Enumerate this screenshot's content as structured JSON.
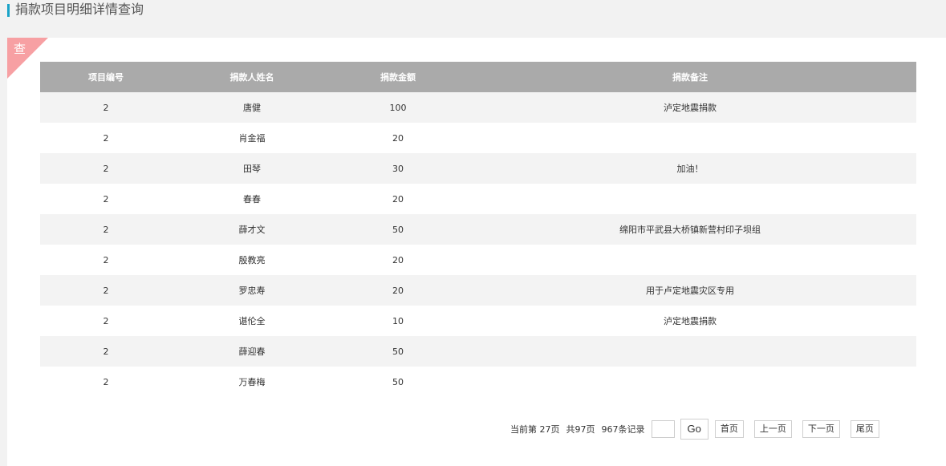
{
  "header": {
    "title": "捐款项目明细详情查询"
  },
  "panel": {
    "corner_label": "查"
  },
  "table": {
    "headers": [
      "项目编号",
      "捐款人姓名",
      "捐款金额",
      "捐款备注"
    ],
    "rows": [
      [
        "2",
        "唐健",
        "100",
        "泸定地震捐款"
      ],
      [
        "2",
        "肖金福",
        "20",
        ""
      ],
      [
        "2",
        "田琴",
        "30",
        "加油！"
      ],
      [
        "2",
        "春春",
        "20",
        ""
      ],
      [
        "2",
        "薛才文",
        "50",
        "绵阳市平武县大桥镇新营村印子坝组"
      ],
      [
        "2",
        "殷教亮",
        "20",
        ""
      ],
      [
        "2",
        "罗忠寿",
        "20",
        "用于卢定地震灾区专用"
      ],
      [
        "2",
        "谌伦全",
        "10",
        "泸定地震捐款"
      ],
      [
        "2",
        "薛迎春",
        "50",
        ""
      ],
      [
        "2",
        "万春梅",
        "50",
        ""
      ]
    ]
  },
  "pager": {
    "current_text": "当前第 27页",
    "total_pages_text": "共97页",
    "records_text": "967条记录",
    "page_input_value": "",
    "go_label": "Go",
    "first_label": "首页",
    "prev_label": "上一页",
    "next_label": "下一页",
    "last_label": "尾页"
  }
}
